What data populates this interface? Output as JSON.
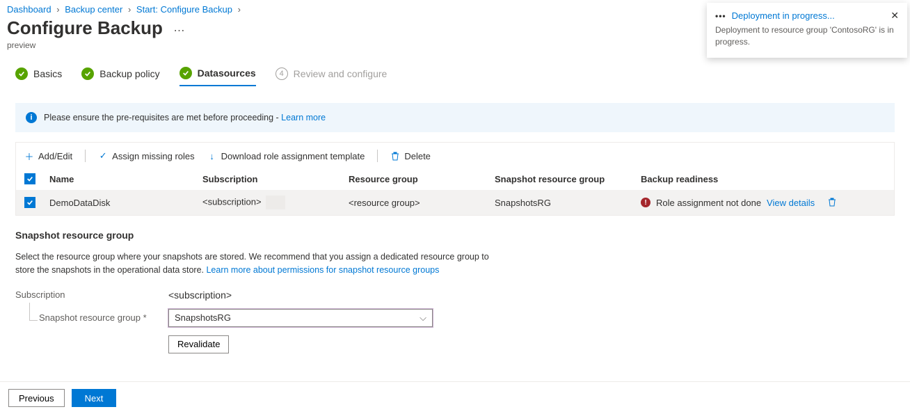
{
  "breadcrumb": {
    "a": "Dashboard",
    "b": "Backup center",
    "c": "Start: Configure Backup"
  },
  "page": {
    "title": "Configure Backup",
    "subtitle": "preview"
  },
  "steps": {
    "s1": "Basics",
    "s2": "Backup policy",
    "s3": "Datasources",
    "s4_num": "4",
    "s4": "Review and configure"
  },
  "info": {
    "text": "Please ensure the pre-requisites are met before proceeding - ",
    "link": "Learn more"
  },
  "toolbar": {
    "add": "Add/Edit",
    "assign": "Assign missing roles",
    "download": "Download role assignment template",
    "delete": "Delete"
  },
  "grid": {
    "h_name": "Name",
    "h_sub": "Subscription",
    "h_rg": "Resource group",
    "h_srg": "Snapshot resource group",
    "h_ready": "Backup readiness",
    "r_name": "DemoDataDisk",
    "r_sub": "<subscription>",
    "r_rg": "<resource group>",
    "r_srg": "SnapshotsRG",
    "r_ready": "Role assignment not done",
    "r_view": "View details"
  },
  "section": {
    "title": "Snapshot resource group",
    "desc": "Select the resource group where your snapshots are stored. We recommend that you assign a dedicated resource group to store the snapshots in the operational data store. ",
    "link": "Learn more about permissions for snapshot resource groups",
    "lbl_sub": "Subscription",
    "val_sub": "<subscription>",
    "lbl_srg": "Snapshot resource group *",
    "val_srg": "SnapshotsRG",
    "revalidate": "Revalidate"
  },
  "footer": {
    "prev": "Previous",
    "next": "Next"
  },
  "toast": {
    "title": "Deployment in progress...",
    "body": "Deployment to resource group 'ContosoRG' is in progress."
  }
}
